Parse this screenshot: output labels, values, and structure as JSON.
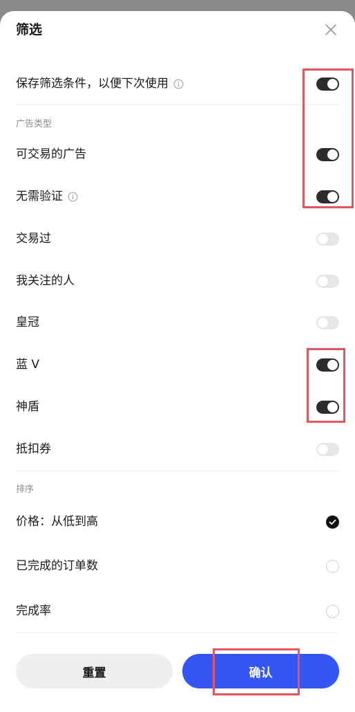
{
  "header": {
    "title": "筛选"
  },
  "save_filter": {
    "label": "保存筛选条件，以便下次使用",
    "enabled": true
  },
  "ad_type": {
    "section_label": "广告类型",
    "items": [
      {
        "label": "可交易的广告",
        "enabled": true
      },
      {
        "label": "无需验证",
        "enabled": true,
        "info": true
      },
      {
        "label": "交易过",
        "enabled": false
      },
      {
        "label": "我关注的人",
        "enabled": false
      },
      {
        "label": "皇冠",
        "enabled": false
      },
      {
        "label": "蓝 V",
        "enabled": true
      },
      {
        "label": "神盾",
        "enabled": true
      },
      {
        "label": "抵扣券",
        "enabled": false
      }
    ]
  },
  "sort": {
    "section_label": "排序",
    "options": [
      {
        "label": "价格：从低到高",
        "selected": true
      },
      {
        "label": "已完成的订单数",
        "selected": false
      },
      {
        "label": "完成率",
        "selected": false
      }
    ]
  },
  "actions": {
    "reset_label": "重置",
    "confirm_label": "确认"
  },
  "colors": {
    "accent": "#3456f5",
    "toggle_on": "#2c2c2c",
    "highlight": "#e0575f"
  }
}
